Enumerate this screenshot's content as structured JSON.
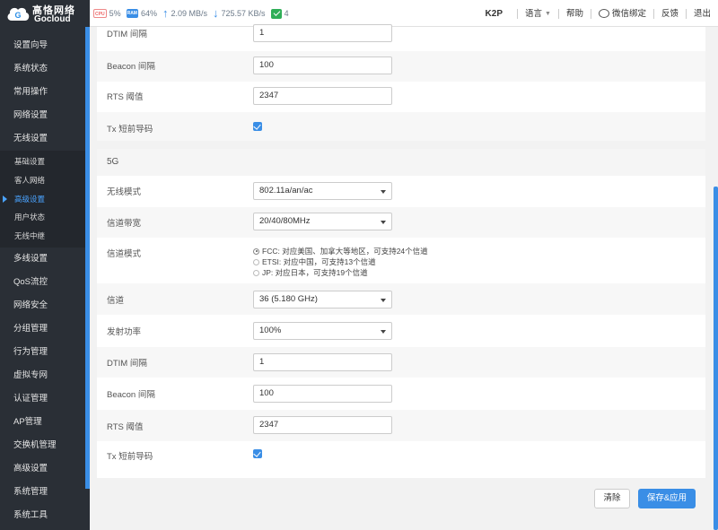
{
  "app": {
    "logo_cn": "高恪网络",
    "logo_en": "Gocloud",
    "model": "K2P"
  },
  "stats": {
    "cpu_chip": "CPU",
    "cpu": "5%",
    "ram_chip": "RAM",
    "ram": "64%",
    "upload": "2.09 MB/s",
    "download": "725.57 KB/s",
    "clients": "4"
  },
  "topnav": {
    "language": "语言",
    "help": "帮助",
    "wechat": "微信绑定",
    "feedback": "反馈",
    "logout": "退出"
  },
  "sidebar": {
    "items_top": [
      "设置向导",
      "系统状态",
      "常用操作",
      "网络设置",
      "无线设置"
    ],
    "sub_items": [
      "基础设置",
      "客人网络",
      "高级设置",
      "用户状态",
      "无线中继"
    ],
    "active_sub": "高级设置",
    "items_bottom": [
      "多线设置",
      "QoS流控",
      "网络安全",
      "分组管理",
      "行为管理",
      "虚拟专网",
      "认证管理",
      "AP管理",
      "交换机管理",
      "高级设置",
      "系统管理",
      "系统工具"
    ]
  },
  "section24": {
    "dtim_label": "DTIM 间隔",
    "dtim_value": "1",
    "beacon_label": "Beacon 间隔",
    "beacon_value": "100",
    "rts_label": "RTS 阈值",
    "rts_value": "2347",
    "tx_label": "Tx 短前导码",
    "tx_checked": true
  },
  "section5g": {
    "title": "5G",
    "mode_label": "无线模式",
    "mode_value": "802.11a/an/ac",
    "bandwidth_label": "信道带宽",
    "bandwidth_value": "20/40/80MHz",
    "channel_mode_label": "信道模式",
    "channel_mode_options": [
      "FCC: 对应美国、加拿大等地区，可支持24个信道",
      "ETSI: 对应中国，可支持13个信道",
      "JP: 对应日本，可支持19个信道"
    ],
    "channel_mode_selected": 0,
    "channel_label": "信道",
    "channel_value": "36 (5.180 GHz)",
    "power_label": "发射功率",
    "power_value": "100%",
    "dtim_label": "DTIM 间隔",
    "dtim_value": "1",
    "beacon_label": "Beacon 间隔",
    "beacon_value": "100",
    "rts_label": "RTS 阈值",
    "rts_value": "2347",
    "tx_label": "Tx 短前导码",
    "tx_checked": true
  },
  "buttons": {
    "clear": "清除",
    "save": "保存&应用"
  },
  "colors": {
    "accent": "#3a8ee6",
    "sidebar_bg": "#2a2f36"
  }
}
